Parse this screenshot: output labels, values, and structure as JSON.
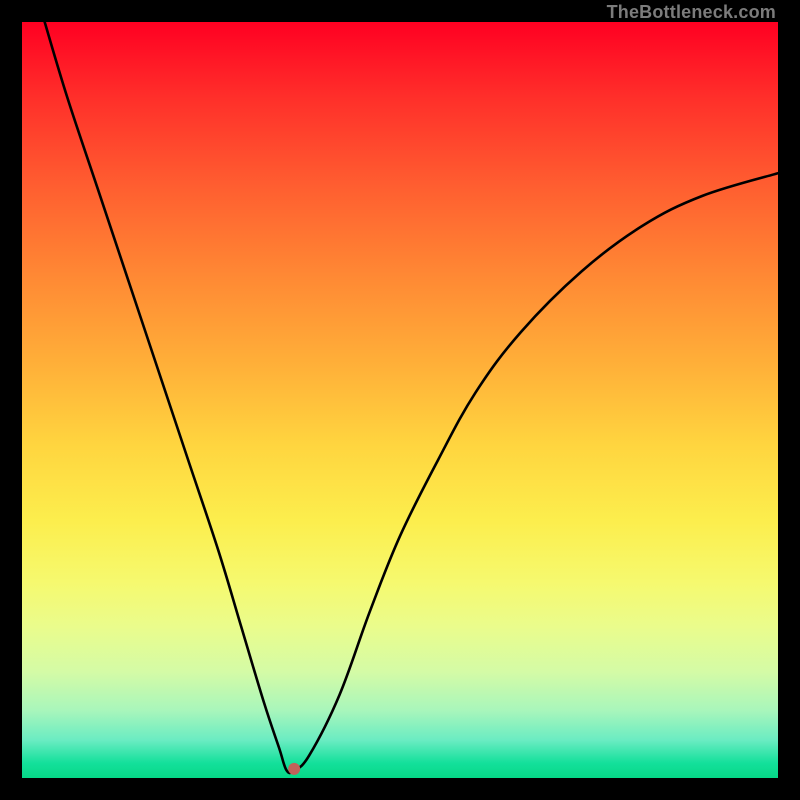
{
  "attribution": "TheBottleneck.com",
  "chart_data": {
    "type": "line",
    "title": "",
    "xlabel": "",
    "ylabel": "",
    "xlim": [
      0,
      100
    ],
    "ylim": [
      0,
      100
    ],
    "series": [
      {
        "name": "curve",
        "x": [
          3,
          6,
          10,
          14,
          18,
          22,
          26,
          29,
          32,
          34,
          35,
          36,
          38,
          42,
          46,
          50,
          55,
          60,
          66,
          74,
          82,
          90,
          100
        ],
        "y": [
          100,
          90,
          78,
          66,
          54,
          42,
          30,
          20,
          10,
          4,
          1,
          1,
          3,
          11,
          22,
          32,
          42,
          51,
          59,
          67,
          73,
          77,
          80
        ]
      }
    ],
    "marker": {
      "x": 36,
      "y": 1.2,
      "color": "#c1615a"
    },
    "background_gradient": {
      "top_color": "#ff0022",
      "bottom_color": "#06d887"
    }
  }
}
